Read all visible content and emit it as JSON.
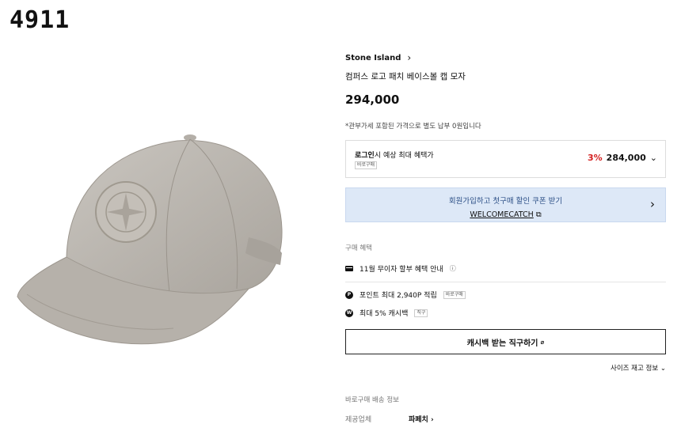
{
  "corner_code": "4911",
  "product": {
    "brand": "Stone Island",
    "title": "컴퍼스 로고 패치 베이스볼 캡 모자",
    "price": "294,000",
    "duty_notice": "*관부가세 포함된 가격으로 별도 납부 0원입니다"
  },
  "benefit_box": {
    "label_bold": "로그인",
    "label_rest": "시 예상 최대 혜택가",
    "tag": "바로구매",
    "discount": "3%",
    "discounted_price": "284,000"
  },
  "coupon": {
    "line1": "회원가입하고 첫구매 할인 쿠폰 받기",
    "code": "WELCOMECATCH"
  },
  "purchase_benefits": {
    "title": "구매 혜택",
    "installment": "11월 무이자 할부 혜택 안내",
    "points": "포인트 최대 2,940P 적립",
    "points_tag": "바로구매",
    "cashback": "최대 5% 캐시백",
    "cashback_tag": "직구"
  },
  "cashback_button": "캐시백 받는 직구하기",
  "size_info": "사이즈 재고 정보",
  "shipping": {
    "title": "바로구매 배송 정보",
    "provider_label": "제공업체",
    "provider_value": "파페치"
  },
  "colors": {
    "discount": "#d42020",
    "coupon_bg": "#dde8f7",
    "cap": "#b9b4ad"
  }
}
